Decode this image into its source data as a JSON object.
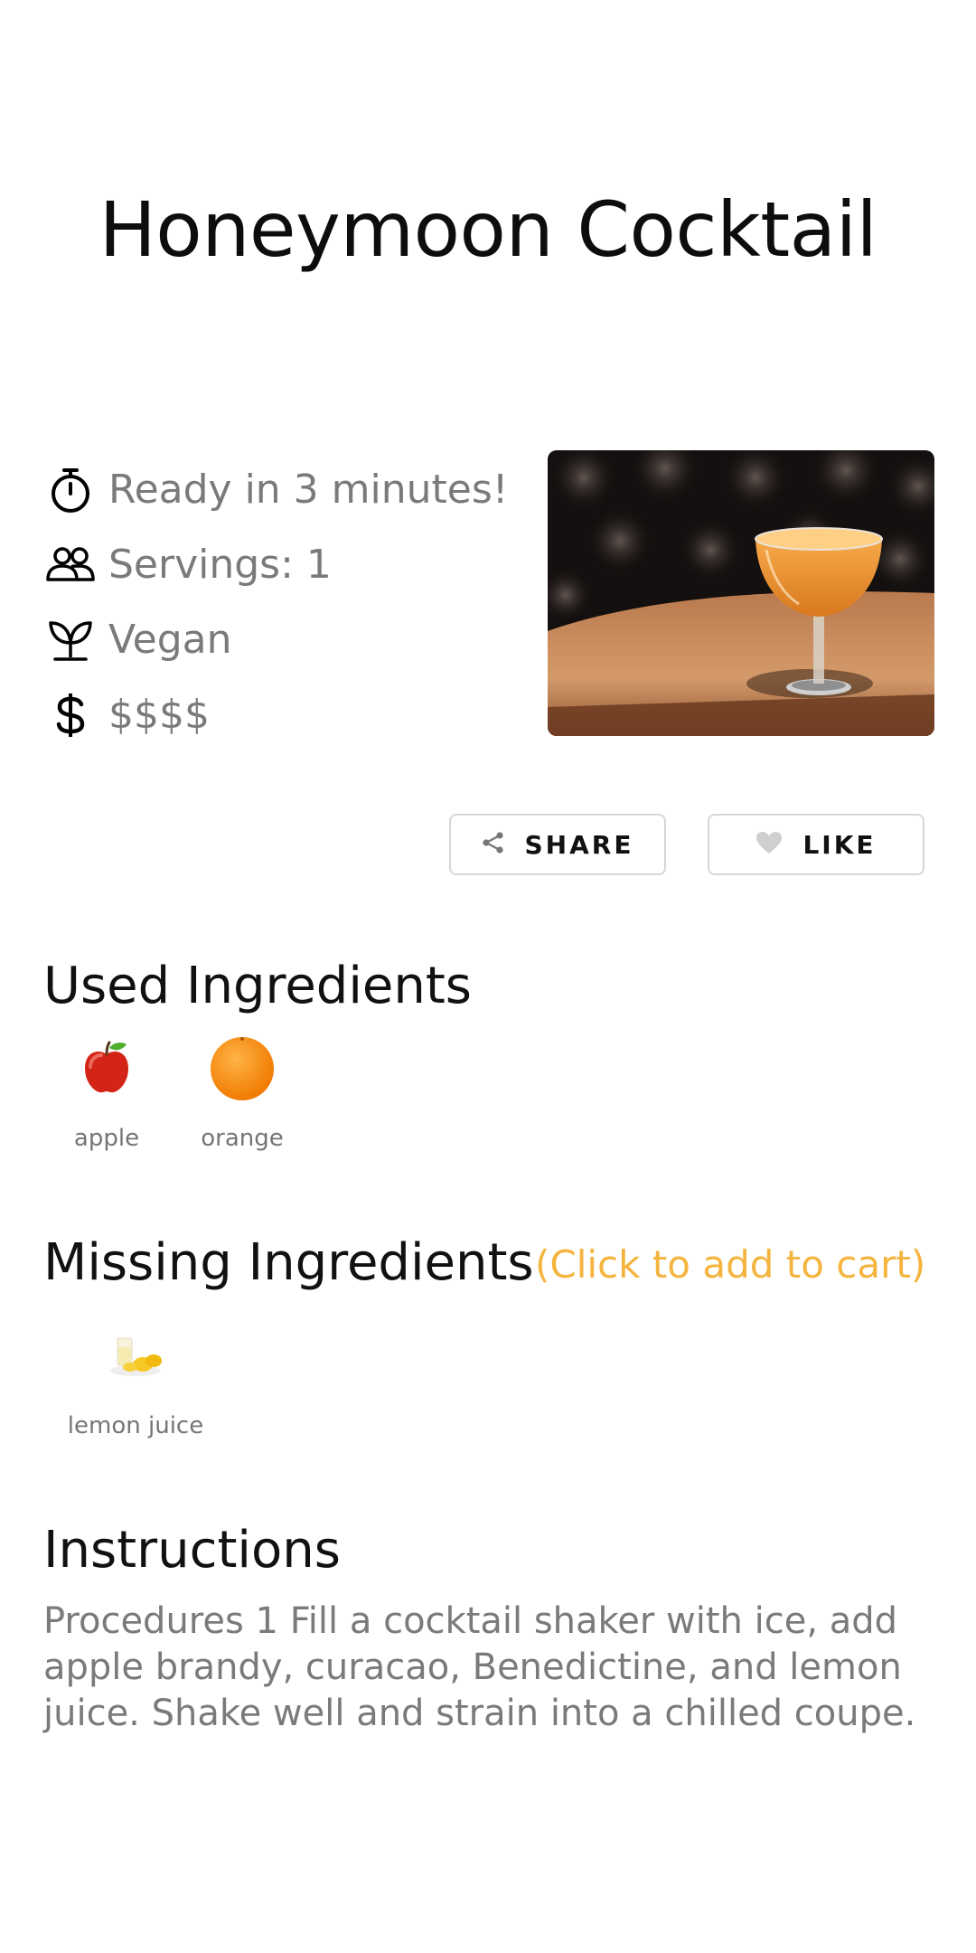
{
  "recipe": {
    "title": "Honeymoon Cocktail",
    "ready_text": "Ready in 3 minutes!",
    "servings_text": "Servings: 1",
    "diet_text": "Vegan",
    "price_text": "$$$$"
  },
  "icons": {
    "ready": "stopwatch-icon",
    "servings": "people-icon",
    "diet": "sprout-icon",
    "price": "dollar-icon",
    "share": "share-icon",
    "like": "heart-icon"
  },
  "actions": {
    "share_label": "SHARE",
    "like_label": "LIKE"
  },
  "used_ingredients": {
    "heading": "Used Ingredients",
    "items": [
      {
        "name": "apple"
      },
      {
        "name": "orange"
      }
    ]
  },
  "missing_ingredients": {
    "heading": "Missing Ingredients",
    "cart_hint": "(Click to add to cart)",
    "items": [
      {
        "name": "lemon juice"
      }
    ]
  },
  "instructions": {
    "heading": "Instructions",
    "text": "Procedures 1 Fill a cocktail shaker with ice, add apple brandy, curacao, Benedictine, and lemon juice. Shake well and strain into a chilled coupe."
  },
  "colors": {
    "accent": "#f4b43e",
    "text_primary": "#111111",
    "text_secondary": "#7a7a7a",
    "button_border": "#d6d6d6"
  }
}
